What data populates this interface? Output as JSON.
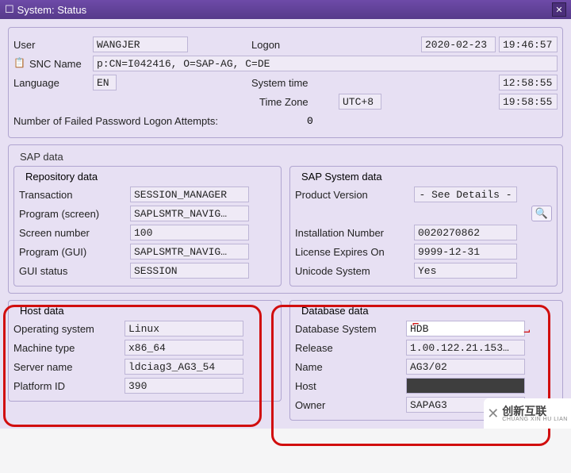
{
  "title": "System: Status",
  "top": {
    "user_lbl": "User",
    "user": "WANGJER",
    "logon_lbl": "Logon",
    "logon_date": "2020-02-23",
    "logon_time": "19:46:57",
    "snc_lbl": "SNC Name",
    "snc": "p:CN=I042416, O=SAP-AG, C=DE",
    "lang_lbl": "Language",
    "lang": "EN",
    "systime_lbl": "System time",
    "systime": "12:58:55",
    "tz_lbl": "Time Zone",
    "tz": "UTC+8",
    "tz_time": "19:58:55",
    "failed_lbl": "Number of Failed Password Logon Attempts:",
    "failed": "0"
  },
  "sap": {
    "legend": "SAP data",
    "repo": {
      "legend": "Repository data",
      "trans_lbl": "Transaction",
      "trans": "SESSION_MANAGER",
      "pscreen_lbl": "Program (screen)",
      "pscreen": "SAPLSMTR_NAVIG…",
      "scrnum_lbl": "Screen number",
      "scrnum": "100",
      "pgui_lbl": "Program (GUI)",
      "pgui": "SAPLSMTR_NAVIG…",
      "gstat_lbl": "GUI status",
      "gstat": "SESSION"
    },
    "sys": {
      "legend": "SAP System data",
      "pv_lbl": "Product Version",
      "pv": "- See Details -",
      "inst_lbl": "Installation Number",
      "inst": "0020270862",
      "lic_lbl": "License Expires On",
      "lic": "9999-12-31",
      "uni_lbl": "Unicode System",
      "uni": "Yes"
    }
  },
  "host": {
    "legend": "Host data",
    "os_lbl": "Operating system",
    "os": "Linux",
    "mt_lbl": "Machine type",
    "mt": "x86_64",
    "sn_lbl": "Server name",
    "sn": "ldciag3_AG3_54",
    "pid_lbl": "Platform ID",
    "pid": "390"
  },
  "db": {
    "legend": "Database data",
    "sys_lbl": "Database System",
    "sys": "HDB",
    "rel_lbl": "Release",
    "rel": "1.00.122.21.153…",
    "name_lbl": "Name",
    "name": "AG3/02",
    "host_lbl": "Host",
    "host": "",
    "owner_lbl": "Owner",
    "owner": "SAPAG3"
  },
  "watermark": {
    "brand": "创新互联",
    "sub": "CHUANG XIN HU LIAN"
  }
}
